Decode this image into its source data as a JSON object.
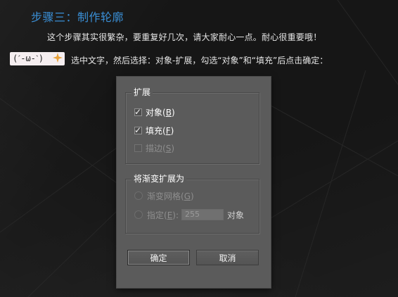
{
  "article": {
    "step_title": "步骤三：制作轮廓",
    "intro": "这个步骤其实很繁杂，要重复好几次，请大家耐心一点。耐心很重要哦！",
    "emoticon": "(ˊ-ω-ˋ)",
    "instruction": "选中文字，然后选择：对象-扩展，勾选“对象”和“填充”后点击确定："
  },
  "dialog": {
    "expand_group": {
      "legend": "扩展",
      "object": {
        "label": "对象",
        "mnemonic": "B",
        "checked": true
      },
      "fill": {
        "label": "填充",
        "mnemonic": "F",
        "checked": true
      },
      "stroke": {
        "label": "描边",
        "mnemonic": "S",
        "checked": false,
        "disabled": true
      }
    },
    "gradient_group": {
      "legend": "将渐变扩展为",
      "mesh": {
        "label": "渐变网格",
        "mnemonic": "G",
        "disabled": true
      },
      "specify": {
        "label": "指定",
        "mnemonic": "E",
        "value": "255",
        "unit": "对象",
        "disabled": true
      }
    },
    "buttons": {
      "ok": "确定",
      "cancel": "取消"
    }
  },
  "colors": {
    "title_blue": "#3a8fd6",
    "page_bg": "#161616",
    "dialog_bg": "#5b5b5b"
  }
}
